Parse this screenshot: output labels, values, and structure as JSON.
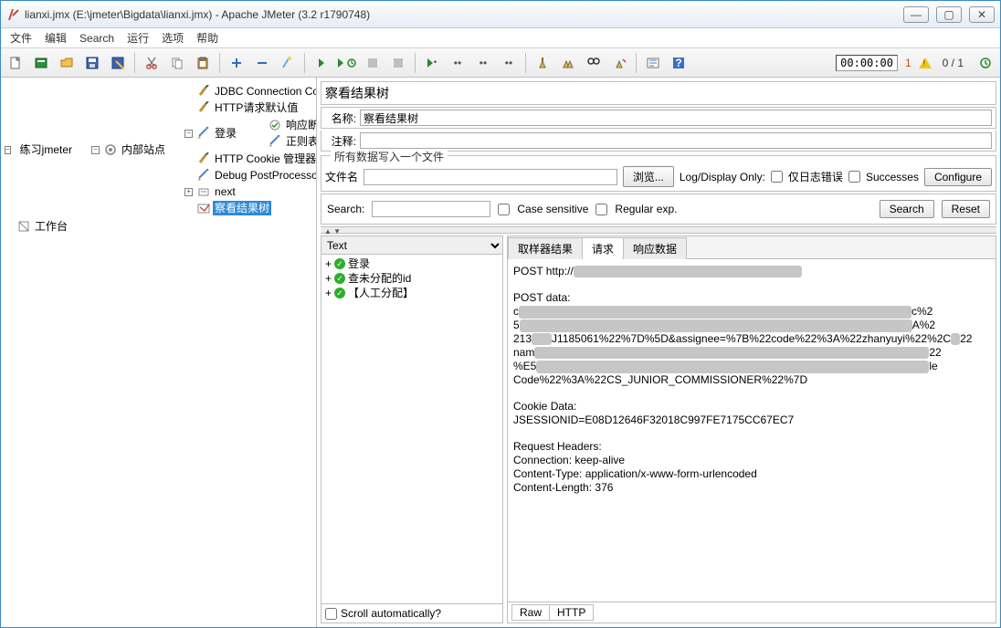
{
  "window": {
    "title": "lianxi.jmx (E:\\jmeter\\Bigdata\\lianxi.jmx) - Apache JMeter (3.2 r1790748)"
  },
  "menu": {
    "items": [
      "文件",
      "编辑",
      "Search",
      "运行",
      "选项",
      "帮助"
    ]
  },
  "toolbar": {
    "timer": "00:00:00",
    "error_count": "1",
    "thread_count": "0 / 1"
  },
  "tree": {
    "root": "练习jmeter",
    "site": "内部站点",
    "jdbc": "JDBC Connection Configuration",
    "http_defaults": "HTTP请求默认值",
    "login": "登录",
    "assert": "响应断言",
    "regex": "正则表达式提取器",
    "cookie": "HTTP Cookie 管理器",
    "debug": "Debug PostProcessor",
    "next": "next",
    "results": "察看结果树",
    "workbench": "工作台"
  },
  "panel": {
    "title": "察看结果树",
    "name_label": "名称:",
    "name_value": "察看结果树",
    "comment_label": "注释:",
    "comment_value": ""
  },
  "file_group": {
    "legend": "所有数据写入一个文件",
    "filename_label": "文件名",
    "filename_value": "",
    "browse": "浏览...",
    "log_display_only": "Log/Display Only:",
    "errors_only": "仅日志错误",
    "successes": "Successes",
    "configure": "Configure"
  },
  "search": {
    "label": "Search:",
    "value": "",
    "case_sensitive": "Case sensitive",
    "regex": "Regular exp.",
    "search_btn": "Search",
    "reset_btn": "Reset"
  },
  "renderer": {
    "selected": "Text"
  },
  "results": {
    "items": [
      "登录",
      "查未分配的id",
      "【人工分配】"
    ],
    "selected_index": 2,
    "scroll_label": "Scroll automatically?"
  },
  "tabs": {
    "sampler": "取样器结果",
    "request": "请求",
    "response": "响应数据",
    "active": "request"
  },
  "request_text": {
    "line1_prefix": "POST http://",
    "line2": "POST data:",
    "frag_a": "c",
    "frag_a_tail": "c%2",
    "frag_b": "5",
    "frag_b_tail": "A%2",
    "frag_c_head": "213",
    "frag_c_mid": "J1185061%22%7D%5D&assignee=%7B%22code%22%3A%22zhanyuyi%22%2C",
    "frag_c_tail": "22",
    "frag_d_head": "nam",
    "frag_d_tail": "22",
    "frag_e_head": "%E5",
    "frag_e_tail": "le",
    "frag_f": "Code%22%3A%22CS_JUNIOR_COMMISSIONER%22%7D",
    "cookie_hdr": "Cookie Data:",
    "cookie_val": "JSESSIONID=E08D12646F32018C997FE7175CC67EC7",
    "headers_hdr": "Request Headers:",
    "h1": "Connection: keep-alive",
    "h2": "Content-Type: application/x-www-form-urlencoded",
    "h3": "Content-Length: 376"
  },
  "bottom_tabs": {
    "raw": "Raw",
    "http": "HTTP",
    "active": "http"
  }
}
